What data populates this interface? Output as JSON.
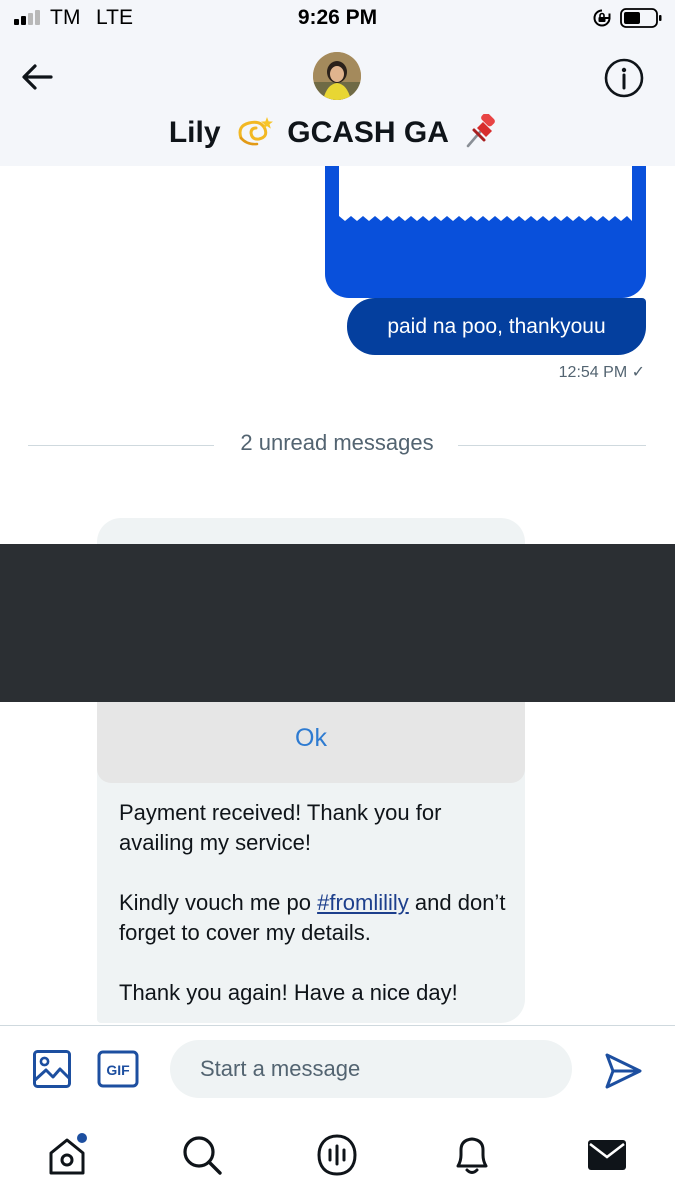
{
  "status_bar": {
    "carrier": "TM",
    "network": "LTE",
    "time": "9:26 PM",
    "signal_bars_filled": 2,
    "signal_bars_total": 4
  },
  "header": {
    "title_name": "Lily",
    "title_suffix": "GCASH GA",
    "title_emojis": [
      "dizzy-symbol",
      "pushpin"
    ],
    "back_icon": "arrow-left-icon",
    "info_icon": "info-icon"
  },
  "conversation": {
    "sent_message": "paid na poo, thankyouu",
    "sent_time": "12:54 PM ✓",
    "unread_divider": "2 unread messages",
    "received": {
      "dialog_ok": "Ok",
      "p1": "Payment received! Thank you for availing my service!",
      "p2_before": "Kindly vouch me po ",
      "p2_hashtag": "#fromlilily",
      "p2_after": " and don’t forget to cover my details.",
      "p3": "Thank you again! Have a nice day!"
    }
  },
  "composer": {
    "placeholder": "Start a message",
    "gif_label": "GIF"
  },
  "tabbar": {
    "items": [
      "home-icon",
      "search-icon",
      "spaces-icon",
      "notifications-icon",
      "messages-icon"
    ]
  },
  "colors": {
    "sent_bubble": "#043f9e",
    "sent_media": "#0950db",
    "received_bubble": "#eff3f4",
    "accent": "#1d9bf0",
    "dialog_link": "#2e7bd1",
    "redaction": "#2b2f33"
  }
}
